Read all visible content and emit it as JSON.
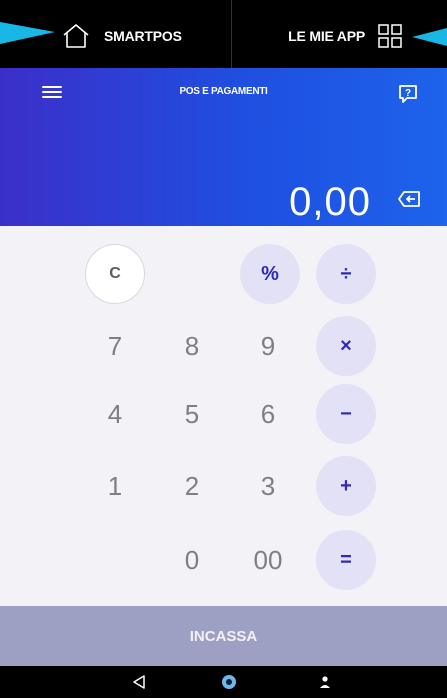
{
  "topbar": {
    "home_label": "SMARTPOS",
    "apps_label": "LE MIE APP"
  },
  "header": {
    "title": "POS E PAGAMENTI",
    "amount": "0,00"
  },
  "keypad": {
    "clear": "C",
    "percent": "%",
    "divide": "÷",
    "multiply": "×",
    "minus": "−",
    "plus": "+",
    "equals": "=",
    "digits": {
      "d7": "7",
      "d8": "8",
      "d9": "9",
      "d4": "4",
      "d5": "5",
      "d6": "6",
      "d1": "1",
      "d2": "2",
      "d3": "3",
      "d0": "0",
      "d00": "00"
    }
  },
  "cta": {
    "label": "INCASSA"
  },
  "colors": {
    "accent": "#2f2bb6",
    "header_start": "#3b2fc9",
    "header_end": "#1d63ec",
    "pointer": "#18b7e6",
    "cta_disabled": "#9da0c2"
  },
  "icons": {
    "home": "home-icon",
    "apps": "grid-icon",
    "menu": "hamburger-menu-icon",
    "help": "help-chat-icon",
    "backspace": "backspace-icon",
    "nav_back": "back-triangle-icon",
    "nav_home": "home-circle-icon",
    "nav_profile": "person-icon"
  }
}
